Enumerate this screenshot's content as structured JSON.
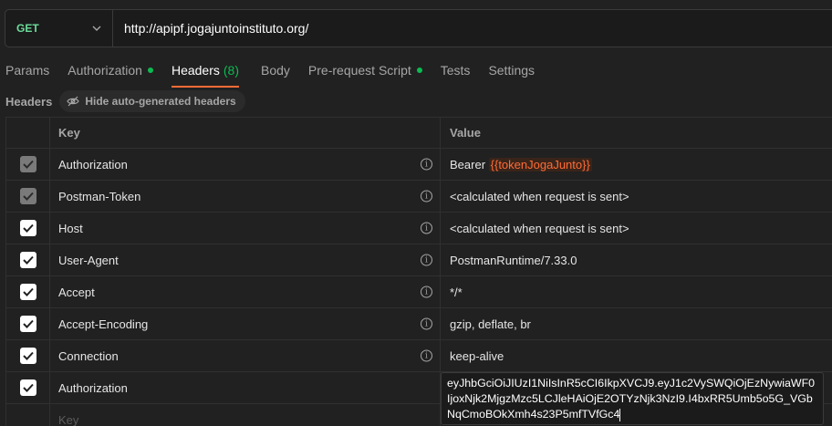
{
  "request": {
    "method": "GET",
    "url": "http://apipf.jogajuntoinstituto.org/"
  },
  "tabs": [
    {
      "label": "Params"
    },
    {
      "label": "Authorization"
    },
    {
      "label": "Headers",
      "count": "(8)"
    },
    {
      "label": "Body"
    },
    {
      "label": "Pre-request Script"
    },
    {
      "label": "Tests"
    },
    {
      "label": "Settings"
    }
  ],
  "headers_section": {
    "title": "Headers",
    "toggle_label": "Hide auto-generated headers"
  },
  "table": {
    "col_key": "Key",
    "col_value": "Value",
    "rows": [
      {
        "key": "Authorization",
        "value_prefix": "Bearer ",
        "value_var": "{{tokenJogaJunto}}"
      },
      {
        "key": "Postman-Token",
        "value": "<calculated when request is sent>"
      },
      {
        "key": "Host",
        "value": "<calculated when request is sent>"
      },
      {
        "key": "User-Agent",
        "value": "PostmanRuntime/7.33.0"
      },
      {
        "key": "Accept",
        "value": "*/*"
      },
      {
        "key": "Accept-Encoding",
        "value": "gzip, deflate, br"
      },
      {
        "key": "Connection",
        "value": "keep-alive"
      },
      {
        "key": "Authorization",
        "value": "eyJhbGciOiJIUzI1NiIsInR5cCI6IkpXVCJ9.eyJ1c2VySWQiOjEzNywiaWF0IjoxNjk2MjgzMzc5LCJleHAiOjE2OTYzNjk3NzI9.I4bxRR5Umb5o5G_VGbNqCmoBOkXmh4s23P5mfTVfGc4"
      }
    ],
    "new_key_placeholder": "Key"
  },
  "colors": {
    "accent": "#ff6c37",
    "method_get": "#6bdd9a",
    "dot": "#0cbb52"
  }
}
